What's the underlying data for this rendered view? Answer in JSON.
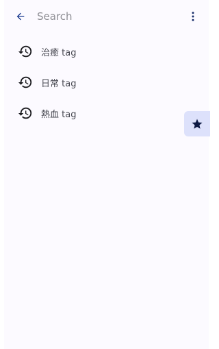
{
  "search": {
    "placeholder": "Search",
    "value": ""
  },
  "icons": {
    "back": "arrow-back-icon",
    "more": "more-vert-icon",
    "history": "history-icon",
    "favorite": "star-icon"
  },
  "history": [
    {
      "label": "治癒 tag"
    },
    {
      "label": "日常 tag"
    },
    {
      "label": "熱血 tag"
    }
  ],
  "colors": {
    "accent": "#1a3a8f",
    "icon": "#1b1b1f",
    "fab_bg": "#dde1fb",
    "fab_icon": "#0e1a44",
    "surface": "#fcfaff"
  }
}
